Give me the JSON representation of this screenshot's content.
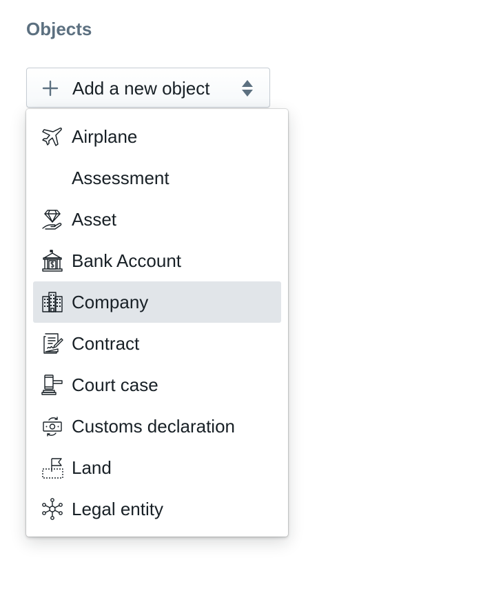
{
  "section": {
    "title": "Objects"
  },
  "add_button": {
    "label": "Add a new object",
    "icon": "plus-icon",
    "caret_icon": "caret-updown-icon"
  },
  "menu": {
    "active_item": "Company",
    "items": [
      {
        "label": "Airplane",
        "icon": "airplane-icon"
      },
      {
        "label": "Assessment",
        "icon": ""
      },
      {
        "label": "Asset",
        "icon": "diamond-hand-icon"
      },
      {
        "label": "Bank Account",
        "icon": "bank-icon"
      },
      {
        "label": "Company",
        "icon": "building-icon"
      },
      {
        "label": "Contract",
        "icon": "contract-icon"
      },
      {
        "label": "Court case",
        "icon": "gavel-icon"
      },
      {
        "label": "Customs declaration",
        "icon": "money-exchange-icon"
      },
      {
        "label": "Land",
        "icon": "land-flag-icon"
      },
      {
        "label": "Legal entity",
        "icon": "network-icon"
      }
    ]
  },
  "colors": {
    "title": "#5c7080",
    "text": "#182026",
    "active_bg": "#e1e5e9",
    "border": "#c5ccd3"
  }
}
